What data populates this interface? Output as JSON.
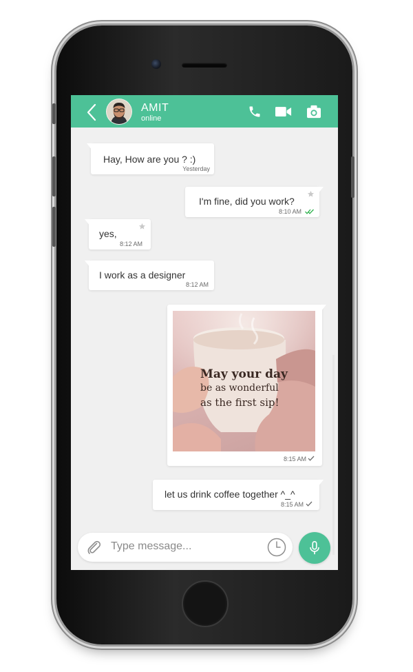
{
  "colors": {
    "accent": "#4dc197",
    "chat_background": "#f0f0f0",
    "bubble": "#ffffff",
    "read_tick": "#2bb04a"
  },
  "header": {
    "back_icon": "chevron-left-icon",
    "contact_name": "AMIT",
    "contact_status": "online",
    "actions": [
      "phone-icon",
      "video-camera-icon",
      "camera-icon"
    ]
  },
  "messages": [
    {
      "direction": "incoming",
      "text": "Hay, How are you ? :)",
      "time": "Yesterday"
    },
    {
      "direction": "outgoing",
      "text": "I'm fine, did you work?",
      "time": "8:10 AM",
      "starred": true,
      "status": "read"
    },
    {
      "direction": "incoming",
      "text": "yes,",
      "time": "8:12 AM",
      "starred": true
    },
    {
      "direction": "incoming",
      "text": "I work as a designer",
      "time": "8:12 AM"
    },
    {
      "direction": "outgoing",
      "type": "image",
      "image_lines": [
        "May your day",
        "be as wonderful",
        "as the first sip!"
      ],
      "time": "8:15 AM",
      "status": "sent"
    },
    {
      "direction": "outgoing",
      "text": "let us drink coffee together ^_^",
      "time": "8:15 AM",
      "status": "sent"
    }
  ],
  "composer": {
    "attach_icon": "paperclip-icon",
    "placeholder": "Type message...",
    "clock_icon": "clock-icon",
    "mic_icon": "microphone-icon"
  }
}
